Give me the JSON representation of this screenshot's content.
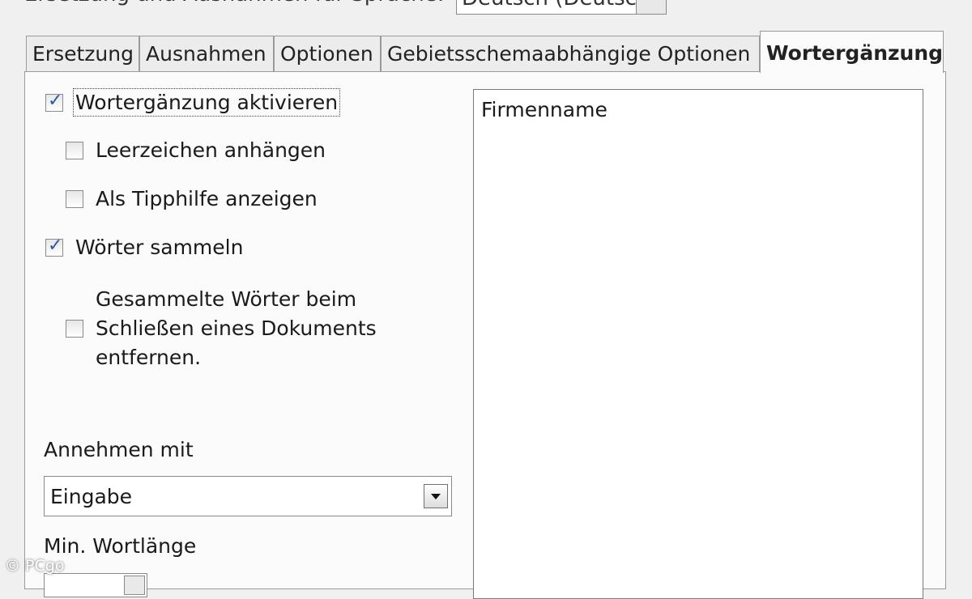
{
  "top": {
    "label_partial": "Ersetzung und Ausnahmen für Sprache:",
    "language_value_partial": "Deutsch (Deutschland)"
  },
  "tabs": [
    {
      "label": "Ersetzung",
      "active": false
    },
    {
      "label": "Ausnahmen",
      "active": false
    },
    {
      "label": "Optionen",
      "active": false
    },
    {
      "label": "Gebietsschemaabhängige Optionen",
      "active": false
    },
    {
      "label": "Wortergänzung",
      "active": true
    }
  ],
  "options": {
    "enable_completion": {
      "label": "Wortergänzung aktivieren",
      "checked": true
    },
    "append_space": {
      "label": "Leerzeichen anhängen",
      "checked": false
    },
    "show_as_tip": {
      "label": "Als Tipphilfe anzeigen",
      "checked": false
    },
    "collect_words": {
      "label": "Wörter sammeln",
      "checked": true
    },
    "remove_on_close": {
      "line1": "Gesammelte Wörter beim",
      "line2": "Schließen eines Dokuments",
      "line3": "entfernen.",
      "checked": false
    }
  },
  "accept_with": {
    "label": "Annehmen mit",
    "value": "Eingabe"
  },
  "min_length": {
    "label": "Min. Wortlänge"
  },
  "word_list": {
    "items": [
      "Firmenname"
    ]
  },
  "watermark": "© PCgo",
  "colors": {
    "check_mark": "#2c5aa0",
    "panel_bg": "#fbfbfb"
  }
}
